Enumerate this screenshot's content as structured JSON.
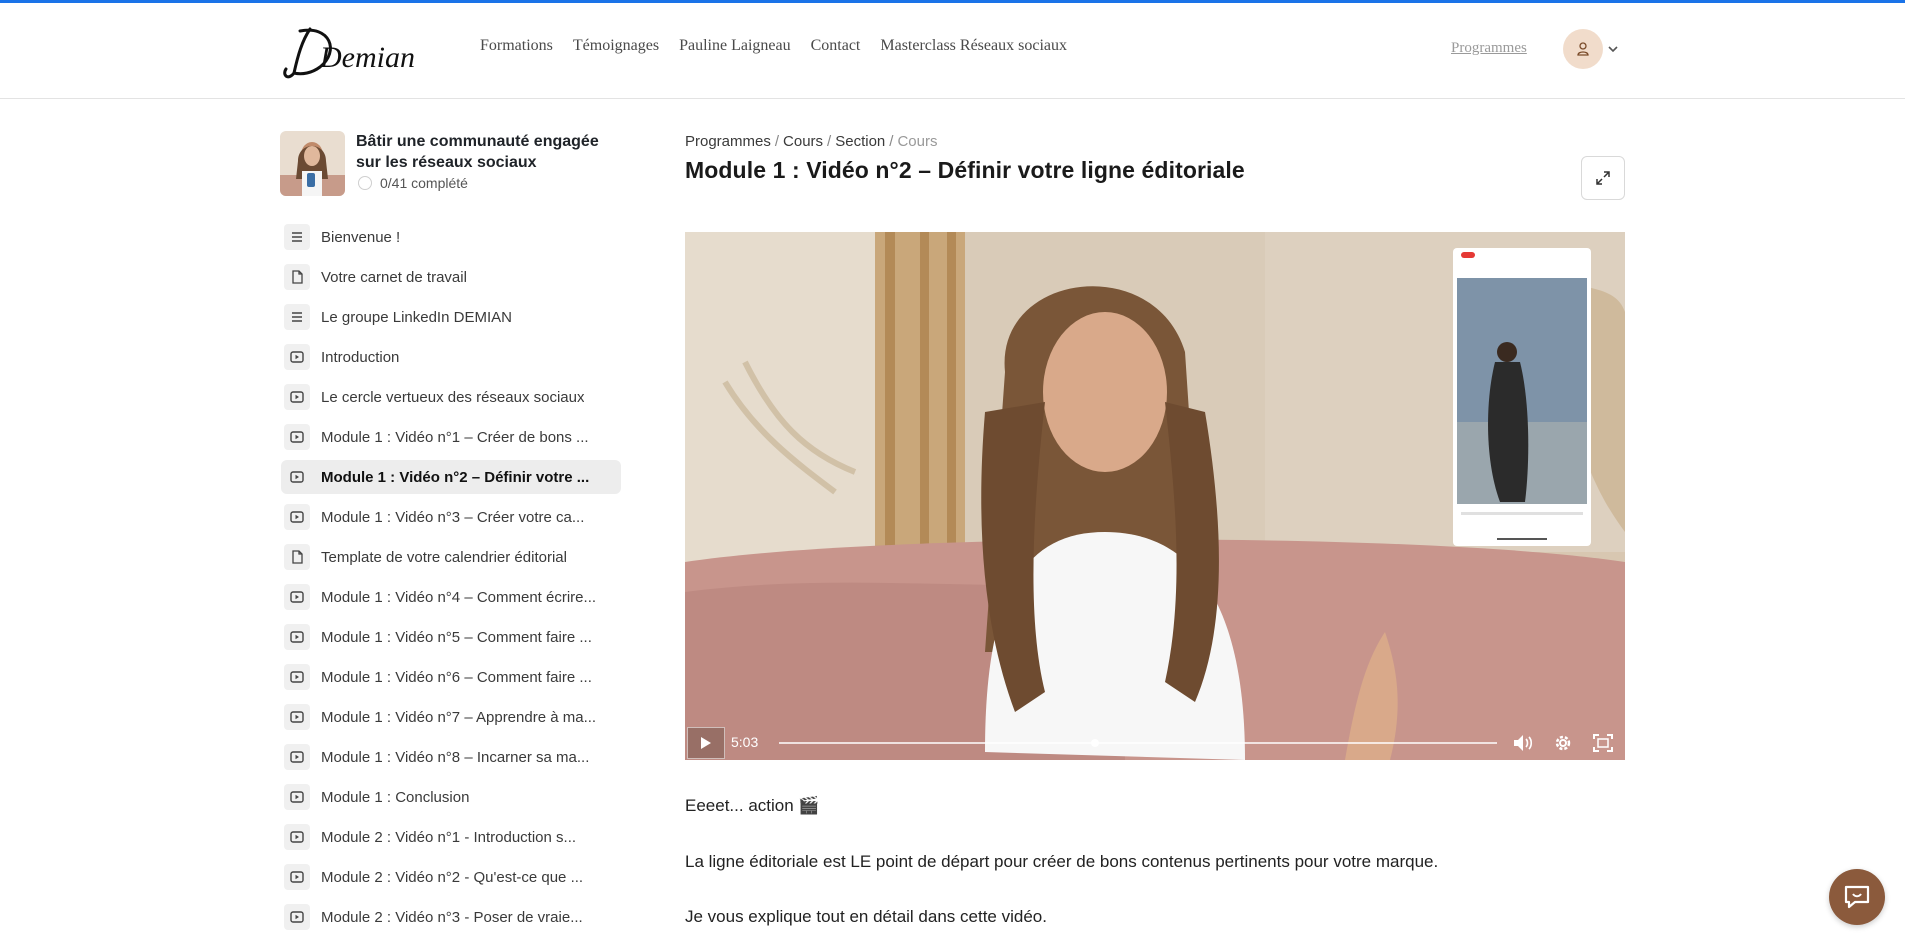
{
  "header": {
    "logo_text": "Demian",
    "nav": [
      "Formations",
      "Témoignages",
      "Pauline Laigneau",
      "Contact",
      "Masterclass Réseaux sociaux"
    ],
    "right_link": "Programmes"
  },
  "course": {
    "title": "Bâtir une communauté engagée sur les réseaux sociaux",
    "progress": "0/41 complété"
  },
  "lessons": [
    {
      "label": "Bienvenue !",
      "icon": "text-lines-icon",
      "active": false
    },
    {
      "label": "Votre carnet de travail",
      "icon": "document-icon",
      "active": false
    },
    {
      "label": "Le groupe LinkedIn DEMIAN",
      "icon": "text-lines-icon",
      "active": false
    },
    {
      "label": "Introduction",
      "icon": "video-play-icon",
      "active": false
    },
    {
      "label": "Le cercle vertueux des réseaux sociaux",
      "icon": "video-play-icon",
      "active": false
    },
    {
      "label": "Module 1 : Vidéo n°1 – Créer de bons ...",
      "icon": "video-play-icon",
      "active": false
    },
    {
      "label": "Module 1 : Vidéo n°2 – Définir votre ...",
      "icon": "video-play-icon",
      "active": true
    },
    {
      "label": "Module 1 : Vidéo n°3 – Créer votre ca...",
      "icon": "video-play-icon",
      "active": false
    },
    {
      "label": "Template de votre calendrier éditorial",
      "icon": "document-icon",
      "active": false
    },
    {
      "label": "Module 1 : Vidéo n°4 – Comment écrire...",
      "icon": "video-play-icon",
      "active": false
    },
    {
      "label": "Module 1 : Vidéo n°5 – Comment faire ...",
      "icon": "video-play-icon",
      "active": false
    },
    {
      "label": "Module 1 : Vidéo n°6 – Comment faire ...",
      "icon": "video-play-icon",
      "active": false
    },
    {
      "label": "Module 1 : Vidéo n°7 – Apprendre à ma...",
      "icon": "video-play-icon",
      "active": false
    },
    {
      "label": "Module 1 : Vidéo n°8 – Incarner sa ma...",
      "icon": "video-play-icon",
      "active": false
    },
    {
      "label": "Module 1 : Conclusion",
      "icon": "video-play-icon",
      "active": false
    },
    {
      "label": "Module 2 : Vidéo n°1 - Introduction s...",
      "icon": "video-play-icon",
      "active": false
    },
    {
      "label": "Module 2 : Vidéo n°2 - Qu'est-ce que ...",
      "icon": "video-play-icon",
      "active": false
    },
    {
      "label": "Module 2 : Vidéo n°3 - Poser de vraie...",
      "icon": "video-play-icon",
      "active": false
    }
  ],
  "breadcrumb": {
    "programmes": "Programmes",
    "cours": "Cours",
    "section": "Section",
    "current": "Cours",
    "sep": "/"
  },
  "lesson_title": "Module 1 : Vidéo n°2 – Définir votre ligne éditoriale",
  "video": {
    "time": "5:03",
    "progress": 0.44
  },
  "body": {
    "p1": "Eeeet... action 🎬",
    "p2": "La ligne éditoriale est LE point de départ pour créer de bons contenus pertinents pour votre marque.",
    "p3": "Je vous explique tout en détail dans cette vidéo."
  },
  "colors": {
    "accent_topline": "#1a73e8",
    "chat_button": "#8b5a3c"
  }
}
